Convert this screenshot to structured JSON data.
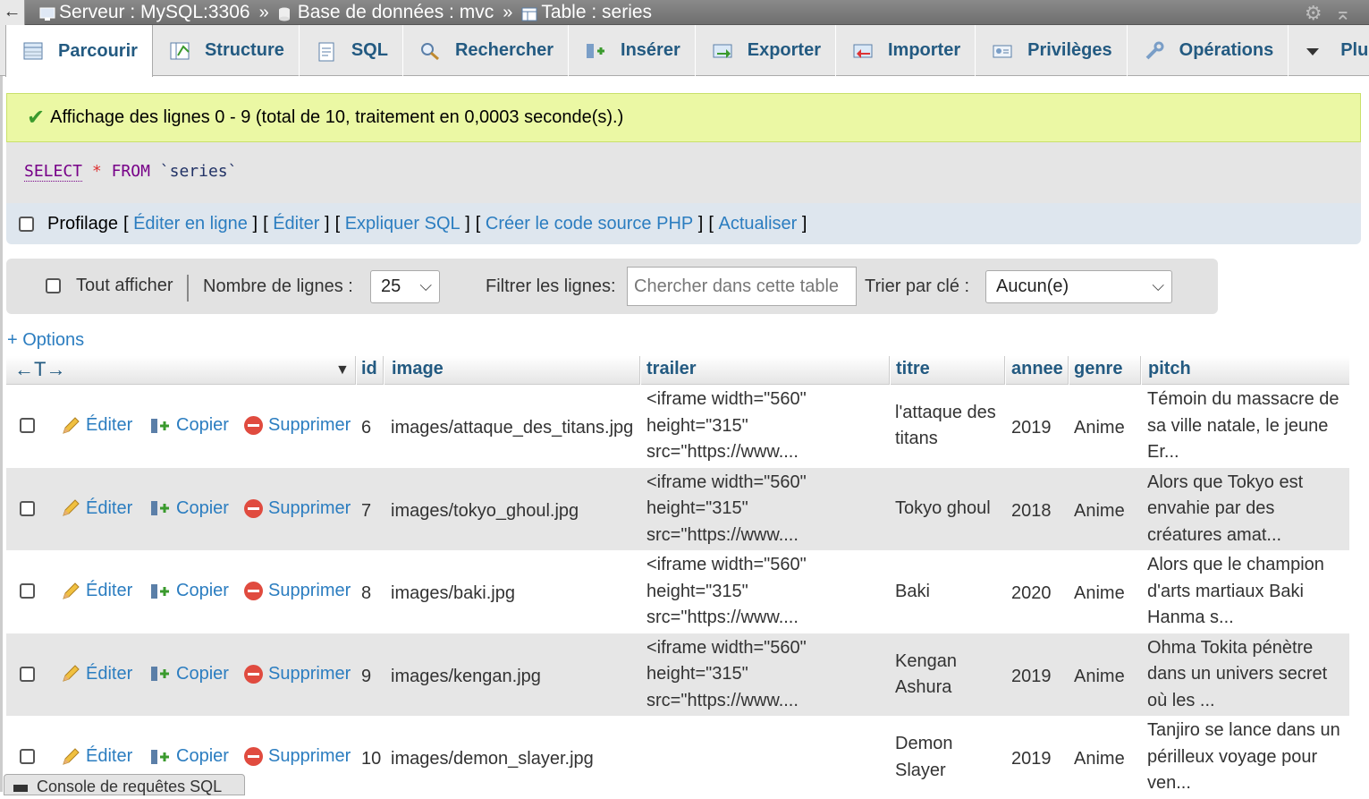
{
  "breadcrumb": {
    "back_label": "←",
    "server": "Serveur : MySQL:3306",
    "database": "Base de données : mvc",
    "table": "Table : series",
    "separator": "»"
  },
  "tabs": [
    {
      "label": "Parcourir",
      "icon": "browse-icon",
      "active": true
    },
    {
      "label": "Structure",
      "icon": "structure-icon"
    },
    {
      "label": "SQL",
      "icon": "sql-icon"
    },
    {
      "label": "Rechercher",
      "icon": "search-icon"
    },
    {
      "label": "Insérer",
      "icon": "insert-icon"
    },
    {
      "label": "Exporter",
      "icon": "export-icon"
    },
    {
      "label": "Importer",
      "icon": "import-icon"
    },
    {
      "label": "Privilèges",
      "icon": "privileges-icon"
    },
    {
      "label": "Opérations",
      "icon": "operations-icon"
    },
    {
      "label": "Plus",
      "icon": "more-icon"
    }
  ],
  "message": {
    "text": "Affichage des lignes 0 - 9 (total de 10, traitement en 0,0003 seconde(s).)"
  },
  "query": {
    "select": "SELECT",
    "star": "*",
    "from": "FROM",
    "table": "`series`"
  },
  "profiling": {
    "label": "Profilage",
    "links": [
      "Éditer en ligne",
      "Éditer",
      "Expliquer SQL",
      "Créer le code source PHP",
      "Actualiser"
    ]
  },
  "navigation": {
    "show_all": "Tout afficher",
    "rows_label": "Nombre de lignes :",
    "rows_value": "25",
    "filter_label": "Filtrer les lignes:",
    "filter_placeholder": "Chercher dans cette table",
    "sort_label": "Trier par clé :",
    "sort_value": "Aucun(e)"
  },
  "options_link": "+ Options",
  "table": {
    "columns": [
      "id",
      "image",
      "trailer",
      "titre",
      "annee",
      "genre",
      "pitch"
    ],
    "actions": {
      "edit": "Éditer",
      "copy": "Copier",
      "delete": "Supprimer"
    },
    "rows": [
      {
        "id": "6",
        "image": "images/attaque_des_titans.jpg",
        "trailer": [
          "<iframe width=\"560\"",
          "height=\"315\"",
          "src=\"https://www...."
        ],
        "titre": [
          "l'attaque des",
          "titans"
        ],
        "annee": "2019",
        "genre": "Anime",
        "pitch": [
          "Témoin du massacre de",
          "sa ville natale, le jeune",
          "Er..."
        ]
      },
      {
        "id": "7",
        "image": "images/tokyo_ghoul.jpg",
        "trailer": [
          "<iframe width=\"560\"",
          "height=\"315\"",
          "src=\"https://www...."
        ],
        "titre": [
          "Tokyo ghoul"
        ],
        "annee": "2018",
        "genre": "Anime",
        "pitch": [
          "Alors que Tokyo est",
          "envahie par des",
          "créatures amat..."
        ]
      },
      {
        "id": "8",
        "image": "images/baki.jpg",
        "trailer": [
          "<iframe width=\"560\"",
          "height=\"315\"",
          "src=\"https://www...."
        ],
        "titre": [
          "Baki"
        ],
        "annee": "2020",
        "genre": "Anime",
        "pitch": [
          "Alors que le champion",
          "d'arts martiaux Baki",
          "Hanma s..."
        ]
      },
      {
        "id": "9",
        "image": "images/kengan.jpg",
        "trailer": [
          "<iframe width=\"560\"",
          "height=\"315\"",
          "src=\"https://www...."
        ],
        "titre": [
          "Kengan",
          "Ashura"
        ],
        "annee": "2019",
        "genre": "Anime",
        "pitch": [
          "Ohma Tokita pénètre",
          "dans un univers secret",
          "où les ..."
        ]
      },
      {
        "id": "10",
        "image": "images/demon_slayer.jpg",
        "trailer": [],
        "titre": [
          "Demon",
          "Slayer"
        ],
        "annee": "2019",
        "genre": "Anime",
        "pitch": [
          "Tanjiro se lance dans un",
          "périlleux voyage pour",
          "ven..."
        ]
      }
    ]
  },
  "console": {
    "label": "Console de requêtes SQL"
  },
  "colors": {
    "link": "#2b7dc0",
    "tab_text": "#235a81",
    "success_bg": "#ebf8a4",
    "delete": "#e04b3f"
  }
}
